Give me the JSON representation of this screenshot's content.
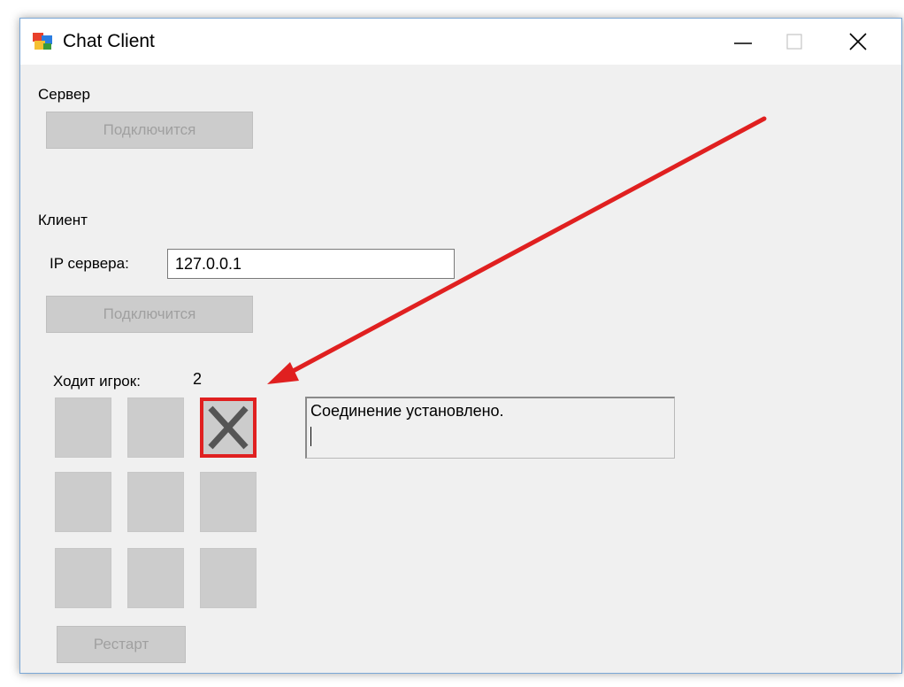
{
  "window": {
    "title": "Chat Client"
  },
  "server_section": {
    "heading": "Сервер",
    "connect_label": "Подключится"
  },
  "client_section": {
    "heading": "Клиент",
    "ip_label": "IP сервера:",
    "ip_value": "127.0.0.1",
    "connect_label": "Подключится"
  },
  "game": {
    "turn_label": "Ходит игрок:",
    "turn_player": "2",
    "board": [
      "",
      "",
      "X",
      "",
      "",
      "",
      "",
      "",
      ""
    ],
    "restart_label": "Рестарт"
  },
  "log": {
    "text": "Соединение установлено."
  },
  "annotation": {
    "arrow_color": "#e02020",
    "highlight_color": "#e02020"
  },
  "icons": {
    "app": "app-form-icon",
    "minimize": "minimize-icon",
    "maximize": "maximize-icon",
    "close": "close-icon",
    "mark": "x-mark-icon"
  }
}
